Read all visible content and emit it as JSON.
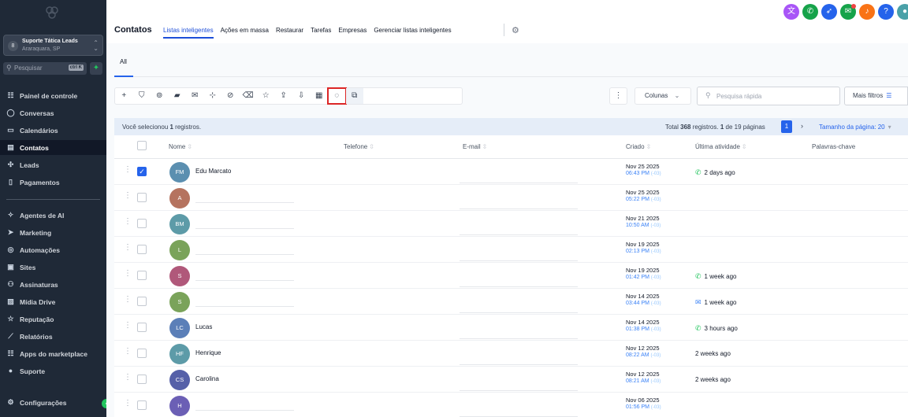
{
  "sidebar": {
    "location_avatar": "8",
    "location_name": "Suporte Tática Leads",
    "location_city": "Araraquara, SP",
    "search_placeholder": "Pesquisar",
    "search_shortcut": "ctrl K",
    "nav_group1": [
      {
        "label": "Painel de controle",
        "icon": "dashboard-icon",
        "glyph": "☷"
      },
      {
        "label": "Conversas",
        "icon": "chat-icon",
        "glyph": "◯"
      },
      {
        "label": "Calendários",
        "icon": "calendar-icon",
        "glyph": "▭"
      },
      {
        "label": "Contatos",
        "icon": "contacts-icon",
        "glyph": "▤",
        "active": true
      },
      {
        "label": "Leads",
        "icon": "leads-icon",
        "glyph": "✣"
      },
      {
        "label": "Pagamentos",
        "icon": "payments-icon",
        "glyph": "▯"
      }
    ],
    "nav_group2": [
      {
        "label": "Agentes de AI",
        "icon": "ai-agents-icon",
        "glyph": "✧"
      },
      {
        "label": "Marketing",
        "icon": "marketing-icon",
        "glyph": "➤"
      },
      {
        "label": "Automações",
        "icon": "automation-icon",
        "glyph": "◎"
      },
      {
        "label": "Sites",
        "icon": "sites-icon",
        "glyph": "▣"
      },
      {
        "label": "Assinaturas",
        "icon": "subscriptions-icon",
        "glyph": "⚇"
      },
      {
        "label": "Mídia Drive",
        "icon": "media-drive-icon",
        "glyph": "▨"
      },
      {
        "label": "Reputação",
        "icon": "reputation-icon",
        "glyph": "☆"
      },
      {
        "label": "Relatórios",
        "icon": "reports-icon",
        "glyph": "⟋"
      },
      {
        "label": "Apps do marketplace",
        "icon": "marketplace-icon",
        "glyph": "☷"
      },
      {
        "label": "Suporte",
        "icon": "support-icon",
        "glyph": "●"
      }
    ],
    "settings_label": "Configurações"
  },
  "header": {
    "title": "Contatos",
    "tabs": [
      "Listas inteligentes",
      "Ações em massa",
      "Restaurar",
      "Tarefas",
      "Empresas",
      "Gerenciar listas inteligentes"
    ],
    "active_tab": "Listas inteligentes",
    "top_icons": [
      {
        "name": "translate-icon",
        "color": "#a855f7",
        "glyph": "文"
      },
      {
        "name": "phone-icon",
        "color": "#16a34a",
        "glyph": "✆"
      },
      {
        "name": "launch-icon",
        "color": "#2563eb",
        "glyph": "➶"
      },
      {
        "name": "megaphone-icon",
        "color": "#16a34a",
        "glyph": "✉",
        "badge": true
      },
      {
        "name": "notification-bell-icon",
        "color": "#f97316",
        "glyph": "♪"
      },
      {
        "name": "help-icon",
        "color": "#2563eb",
        "glyph": "?"
      },
      {
        "name": "user-avatar-icon",
        "color": "#4aa1a8",
        "glyph": "●"
      }
    ]
  },
  "list": {
    "tab_all": "All",
    "toolbar_icons": [
      {
        "name": "add-icon",
        "glyph": "+"
      },
      {
        "name": "filter-icon",
        "glyph": "⛉"
      },
      {
        "name": "automation-add-icon",
        "glyph": "⊚"
      },
      {
        "name": "sms-icon",
        "glyph": "▰"
      },
      {
        "name": "email-icon",
        "glyph": "✉"
      },
      {
        "name": "add-tag-icon",
        "glyph": "⊹"
      },
      {
        "name": "remove-tag-icon",
        "glyph": "⊘"
      },
      {
        "name": "delete-icon",
        "glyph": "⌫"
      },
      {
        "name": "star-icon",
        "glyph": "☆"
      },
      {
        "name": "export-icon",
        "glyph": "⇪"
      },
      {
        "name": "import-icon",
        "glyph": "⇩"
      },
      {
        "name": "company-icon",
        "glyph": "▦"
      },
      {
        "name": "whatsapp-icon",
        "glyph": "◌",
        "highlighted": true
      },
      {
        "name": "duplicate-icon",
        "glyph": "⧉"
      }
    ],
    "columns_label": "Colunas",
    "quick_search_placeholder": "Pesquisa rápida",
    "more_filters_label": "Mais filtros",
    "selection": {
      "prefix": "Você selecionou ",
      "count": "1",
      "suffix": " registros."
    },
    "pagination": {
      "total_label": "Total ",
      "total": "368",
      "registros_label": " registros. ",
      "page": "1",
      "of_label": " de 19 páginas",
      "current_page_button": "1",
      "next": "›",
      "page_size": "Tamanho da página: 20"
    },
    "columns": [
      "Nome",
      "Telefone",
      "E-mail",
      "Criado",
      "Última atividade",
      "Palavras-chave"
    ],
    "rows": [
      {
        "initials": "FM",
        "color": "#5b8fb0",
        "name": "Edu Marcato",
        "checked": true,
        "date": "Nov 25 2025",
        "time": "06:43 PM",
        "tz": "(-03)",
        "activity": "2 days ago",
        "activity_icon": "whatsapp"
      },
      {
        "initials": "A",
        "color": "#b5735f",
        "name": "",
        "checked": false,
        "date": "Nov 25 2025",
        "time": "05:22 PM",
        "tz": "(-03)",
        "activity": "",
        "activity_icon": ""
      },
      {
        "initials": "BM",
        "color": "#5d9ba8",
        "name": "",
        "checked": false,
        "date": "Nov 21 2025",
        "time": "10:50 AM",
        "tz": "(-03)",
        "activity": "",
        "activity_icon": ""
      },
      {
        "initials": "L",
        "color": "#7aa35a",
        "name": "",
        "checked": false,
        "date": "Nov 19 2025",
        "time": "02:13 PM",
        "tz": "(-03)",
        "activity": "",
        "activity_icon": ""
      },
      {
        "initials": "S",
        "color": "#b0587a",
        "name": "",
        "checked": false,
        "date": "Nov 19 2025",
        "time": "01:42 PM",
        "tz": "(-03)",
        "activity": "1 week ago",
        "activity_icon": "whatsapp"
      },
      {
        "initials": "S",
        "color": "#7aa35a",
        "name": "",
        "checked": false,
        "date": "Nov 14 2025",
        "time": "03:44 PM",
        "tz": "(-03)",
        "activity": "1 week ago",
        "activity_icon": "email"
      },
      {
        "initials": "LC",
        "color": "#5b7fb8",
        "name": "Lucas",
        "checked": false,
        "date": "Nov 14 2025",
        "time": "01:38 PM",
        "tz": "(-03)",
        "activity": "3 hours ago",
        "activity_icon": "whatsapp"
      },
      {
        "initials": "HF",
        "color": "#5d9ba8",
        "name": "Henrique",
        "checked": false,
        "date": "Nov 12 2025",
        "time": "08:22 AM",
        "tz": "(-03)",
        "activity": "2 weeks ago",
        "activity_icon": ""
      },
      {
        "initials": "CS",
        "color": "#5560a8",
        "name": "Carolina",
        "checked": false,
        "date": "Nov 12 2025",
        "time": "08:21 AM",
        "tz": "(-03)",
        "activity": "2 weeks ago",
        "activity_icon": ""
      },
      {
        "initials": "H",
        "color": "#6b5fb5",
        "name": "",
        "checked": false,
        "date": "Nov 06 2025",
        "time": "01:56 PM",
        "tz": "(-03)",
        "activity": "",
        "activity_icon": ""
      }
    ]
  }
}
